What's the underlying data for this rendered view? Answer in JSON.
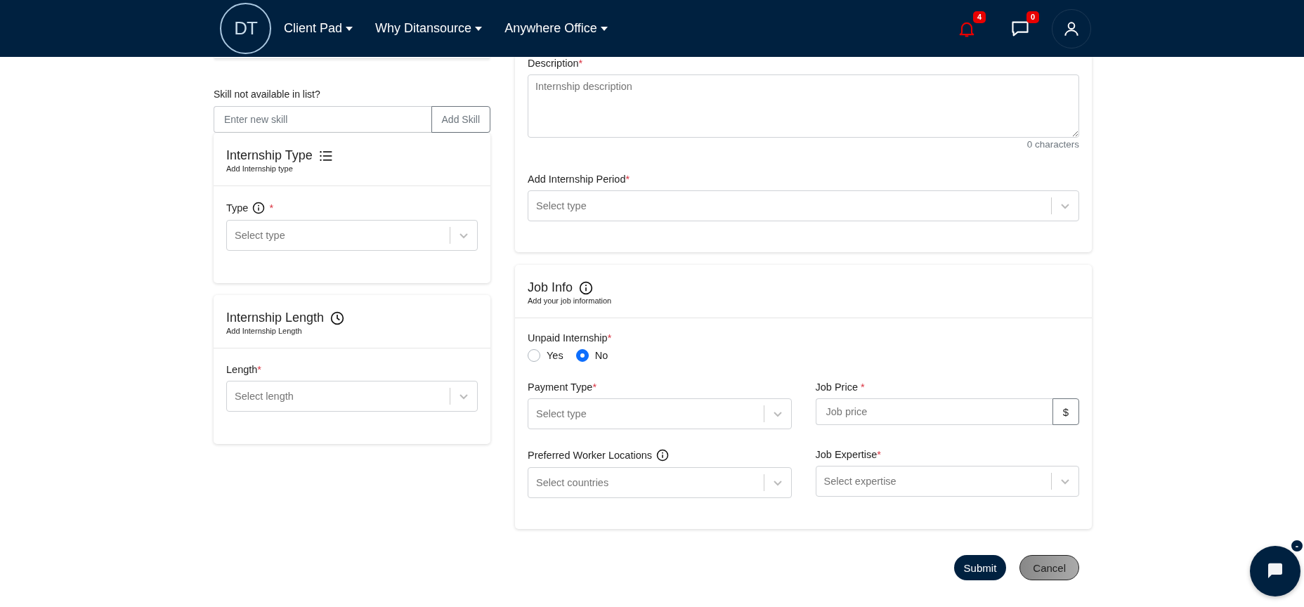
{
  "nav": {
    "logo": "DT",
    "menus": [
      {
        "label": "Client Pad"
      },
      {
        "label": "Why Ditansource"
      },
      {
        "label": "Anywhere Office"
      }
    ],
    "notifications": {
      "count": "4"
    },
    "messages": {
      "count": "0"
    }
  },
  "skill": {
    "prompt": "Skill not available in list?",
    "placeholder": "Enter new skill",
    "button": "Add Skill"
  },
  "left_cards": [
    {
      "title": "Internship Type",
      "subtitle": "Add Internship type",
      "fields": [
        {
          "kind": "select",
          "label": "Type",
          "info": true,
          "mark": "*",
          "placeholder": "Select type"
        }
      ]
    },
    {
      "title": "Internship Length",
      "subtitle": "Add Internship Length",
      "fields": [
        {
          "kind": "select",
          "label": "Length",
          "info": false,
          "mark": "*",
          "placeholder": "Select length"
        }
      ]
    }
  ],
  "description_card": {
    "fields": [
      {
        "kind": "textarea",
        "label": "Description",
        "info": false,
        "mark": "*",
        "placeholder": "Internship description",
        "counter": "0 characters"
      },
      {
        "kind": "select",
        "label": "Add Internship Period",
        "info": false,
        "mark": "*",
        "placeholder": "Select type"
      }
    ]
  },
  "job_info": {
    "title": "Job Info",
    "subtitle": "Add your job information",
    "fields": [
      {
        "kind": "radio",
        "label": "Unpaid Internship",
        "info": false,
        "mark": "*",
        "options": [
          {
            "label": "Yes",
            "selected": false
          },
          {
            "label": "No",
            "selected": true
          }
        ]
      },
      {
        "kind": "select",
        "label": "Payment Type",
        "info": false,
        "mark": "*",
        "placeholder": "Select type"
      },
      {
        "kind": "addon",
        "label": "Job Price",
        "info": false,
        "mark": " *",
        "placeholder": "Job price",
        "addon": "$"
      },
      {
        "kind": "select",
        "label": "Preferred Worker Locations",
        "info": true,
        "placeholder": "Select countries"
      },
      {
        "kind": "select",
        "label": "Job Expertise",
        "info": false,
        "mark": "*",
        "placeholder": "Select expertise"
      }
    ]
  },
  "actions": [
    {
      "label": "Submit",
      "kind": "primary"
    },
    {
      "label": "Cancel",
      "kind": "secondary"
    }
  ],
  "chat_widget": {
    "minimized_mark": "-"
  }
}
